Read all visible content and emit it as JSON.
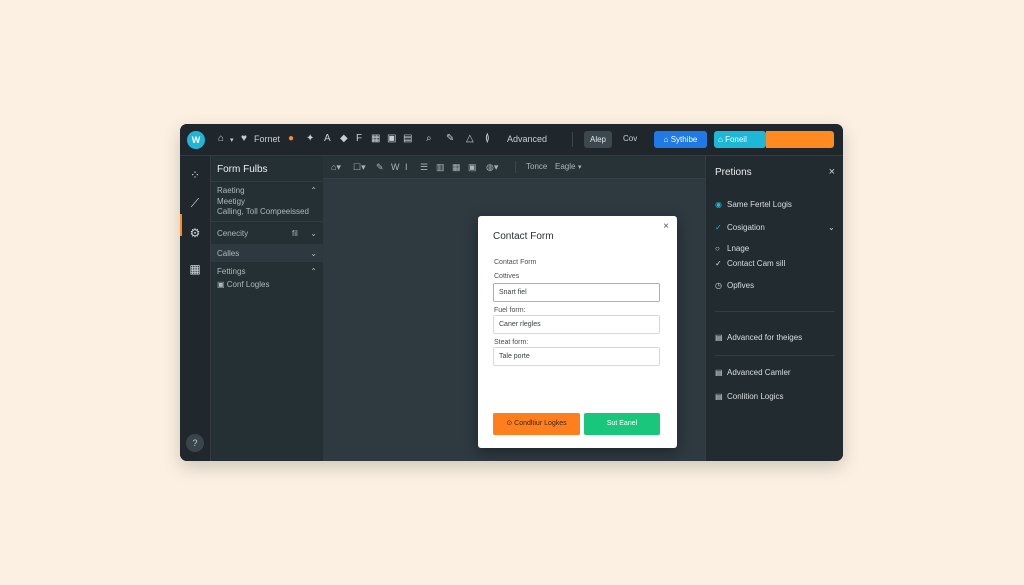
{
  "app": {
    "logo_text": "W",
    "topbar": {
      "format_label": "Fornet",
      "advanced_label": "Advanced",
      "tab_alert": "Alep",
      "tab_csv": "Cov",
      "publish_button": "Sythibe",
      "preview_button": "Foneil"
    },
    "left_panel": {
      "title": "Form Fulbs",
      "section1_label": "Raeting",
      "section1_lines": [
        "Meetigy",
        "Calling, Toll Compeeissed"
      ],
      "connectivity_label": "Cenecity",
      "connectivity_count": "fil",
      "calles_label": "Calles",
      "settings_label": "Fettings",
      "conf_logic_label": "Conf Logles"
    },
    "canvas_toolbar": {
      "item_a": "Tonce",
      "item_b": "Eagle"
    },
    "modal": {
      "title": "Contact Form",
      "subtitle": "Contact Form",
      "field1_label": "Cottives",
      "field1_value": "Snart fiel",
      "field2_label": "Fuel form:",
      "field2_value": "Caner rlegles",
      "field3_label": "Steat form:",
      "field3_value": "Tale porte",
      "btn_conditional": "Condltiur Logkes",
      "btn_submit": "Sut Eanel",
      "close_symbol": "×"
    },
    "right_panel": {
      "title": "Pretions",
      "close_symbol": "×",
      "items": [
        "Same Fertel Logis",
        "Cosigation",
        "Lnage",
        "Contact Cam sill",
        "Opfives",
        "Advanced for theiges",
        "Advanced Camler",
        "Conlition Logics"
      ]
    }
  },
  "colors": {
    "background": "#fcf0e2",
    "app_dark": "#262f35",
    "accent_orange": "#ff8a1f",
    "accent_blue": "#1f7ae6",
    "accent_cyan": "#1db7d8",
    "accent_green": "#19c77c"
  }
}
